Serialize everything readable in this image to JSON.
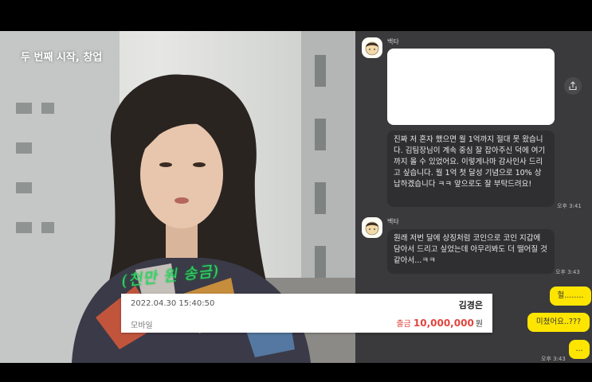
{
  "video": {
    "title": "두 번째 시작, 창업",
    "handwritten_caption": "(천만 원 송금)"
  },
  "transfer": {
    "datetime": "2022.04.30 15:40:50",
    "name": "김경은",
    "channel": "모바일",
    "amount_label": "출금",
    "amount": "10,000,000",
    "currency": "원",
    "amount_color": "#e0453f"
  },
  "chat": {
    "background": "#3a3a3c",
    "messages": [
      {
        "sender": "백타",
        "bubbles": [
          "",
          "진짜 저 혼자 했으면 월 1억까지 절대 못 왔습니다. 김팀장님이 계속 중심 잘 잡아주신 덕에 여기까지 올 수 있었어요. 이렇게나마 감사인사 드리고 싶습니다. 월 1억 첫 달성 기념으로 10% 상납하겠습니다 ㅋㅋ 앞으로도 잘 부탁드려요!"
        ],
        "time": "오후 3:41"
      },
      {
        "sender": "백타",
        "bubbles": [
          "원래 저번 달에 상징처럼 코인으로 코인 지갑에 담아서 드리고 싶었는데 아무리봐도 더 떨어질 것 같아서...ㅋㅋ"
        ],
        "time": "오후 3:43"
      }
    ],
    "replies": [
      "헐........",
      "미쳤어요..???",
      "..."
    ],
    "reply_time": "오후 3:43",
    "reply_color": "#fee500"
  },
  "icons": {
    "share": "share-icon",
    "avatar": "sender-avatar"
  }
}
